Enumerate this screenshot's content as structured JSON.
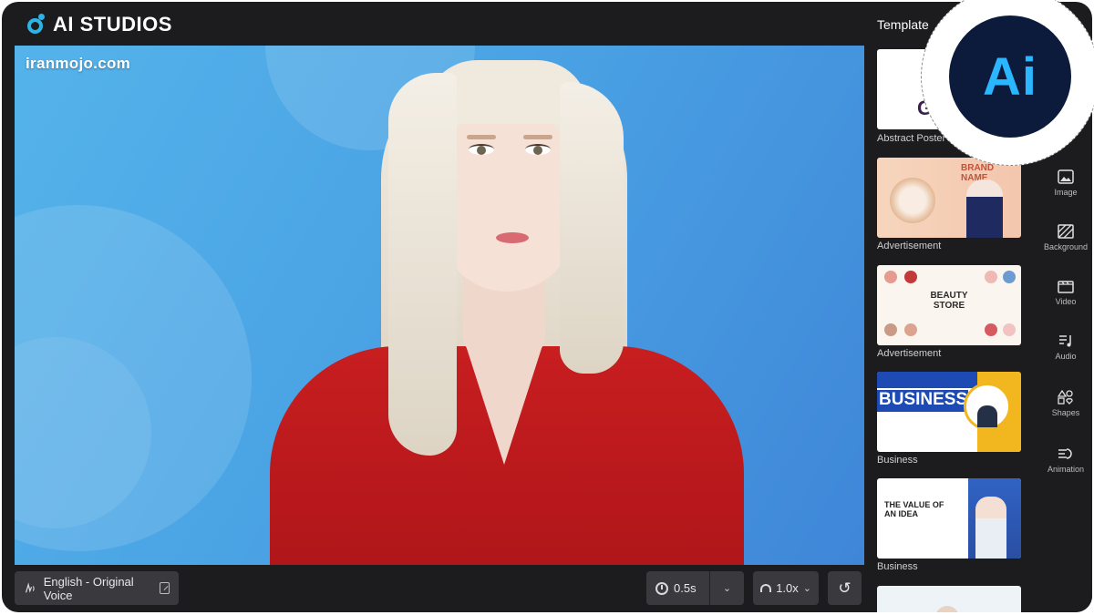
{
  "app": {
    "title": "AI STUDIOS",
    "watermark": "iranmojo.com",
    "accent": "#2ab5e8"
  },
  "toolbar": {
    "voice_label": "English - Original Voice",
    "pause_value": "0.5s",
    "speed_value": "1.0x",
    "icons": [
      "voice-wave-icon",
      "external-link-icon",
      "clock-icon",
      "chevron-down-icon",
      "speedometer-icon",
      "reset-icon"
    ]
  },
  "templates": {
    "title": "Template",
    "items": [
      {
        "label": "Abstract Poster",
        "preview_text": "GR"
      },
      {
        "label": "Advertisement",
        "preview_text": "BRAND NAME"
      },
      {
        "label": "Advertisement",
        "preview_text": "BEAUTY STORE"
      },
      {
        "label": "Business",
        "preview_text": "BUSINESS"
      },
      {
        "label": "Business",
        "preview_text": "THE VALUE OF AN IDEA"
      },
      {
        "label": "",
        "preview_text": ""
      }
    ]
  },
  "rail": {
    "items": [
      {
        "label": "Image",
        "icon": "image-icon"
      },
      {
        "label": "Background",
        "icon": "background-icon"
      },
      {
        "label": "Video",
        "icon": "video-icon"
      },
      {
        "label": "Audio",
        "icon": "audio-icon"
      },
      {
        "label": "Shapes",
        "icon": "shapes-icon"
      },
      {
        "label": "Animation",
        "icon": "animation-icon"
      }
    ]
  },
  "badge": {
    "text": "Ai",
    "colors": {
      "bg": "#0c1b3b",
      "text": "#2ab7ff"
    }
  }
}
